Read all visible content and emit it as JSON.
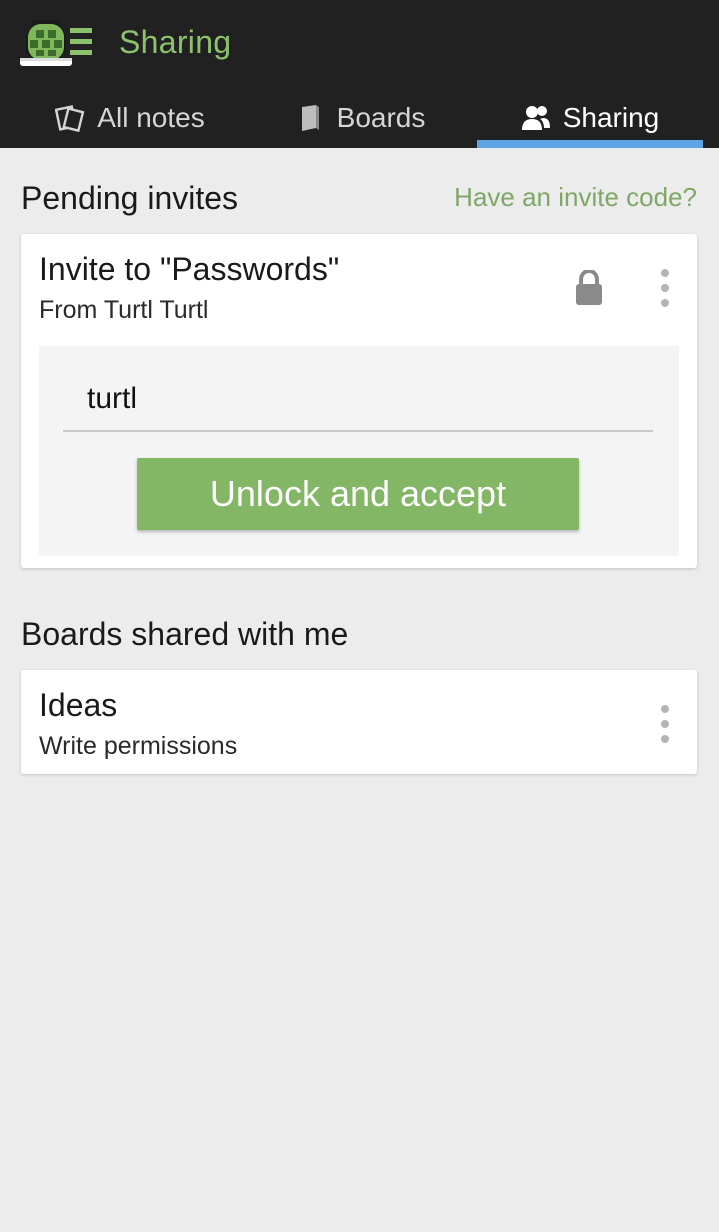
{
  "header": {
    "app_title": "Sharing",
    "logo_icon": "turtle-logo-icon"
  },
  "tabs": [
    {
      "label": "All notes",
      "icon": "notes-icon",
      "active": false
    },
    {
      "label": "Boards",
      "icon": "board-icon",
      "active": false
    },
    {
      "label": "Sharing",
      "icon": "people-icon",
      "active": true
    }
  ],
  "pending": {
    "heading": "Pending invites",
    "invite_code_link": "Have an invite code?",
    "invites": [
      {
        "title": "Invite to \"Passwords\"",
        "from": "From Turtl Turtl",
        "lock_icon": "lock-icon",
        "password_value": "turtl",
        "accept_label": "Unlock and accept"
      }
    ]
  },
  "shared": {
    "heading": "Boards shared with me",
    "boards": [
      {
        "title": "Ideas",
        "permissions": "Write permissions"
      }
    ]
  },
  "colors": {
    "topbar": "#212121",
    "accent_green": "#83b665",
    "title_green": "#8cc26c",
    "tab_underline": "#5ea3e8",
    "background": "#ececec"
  }
}
